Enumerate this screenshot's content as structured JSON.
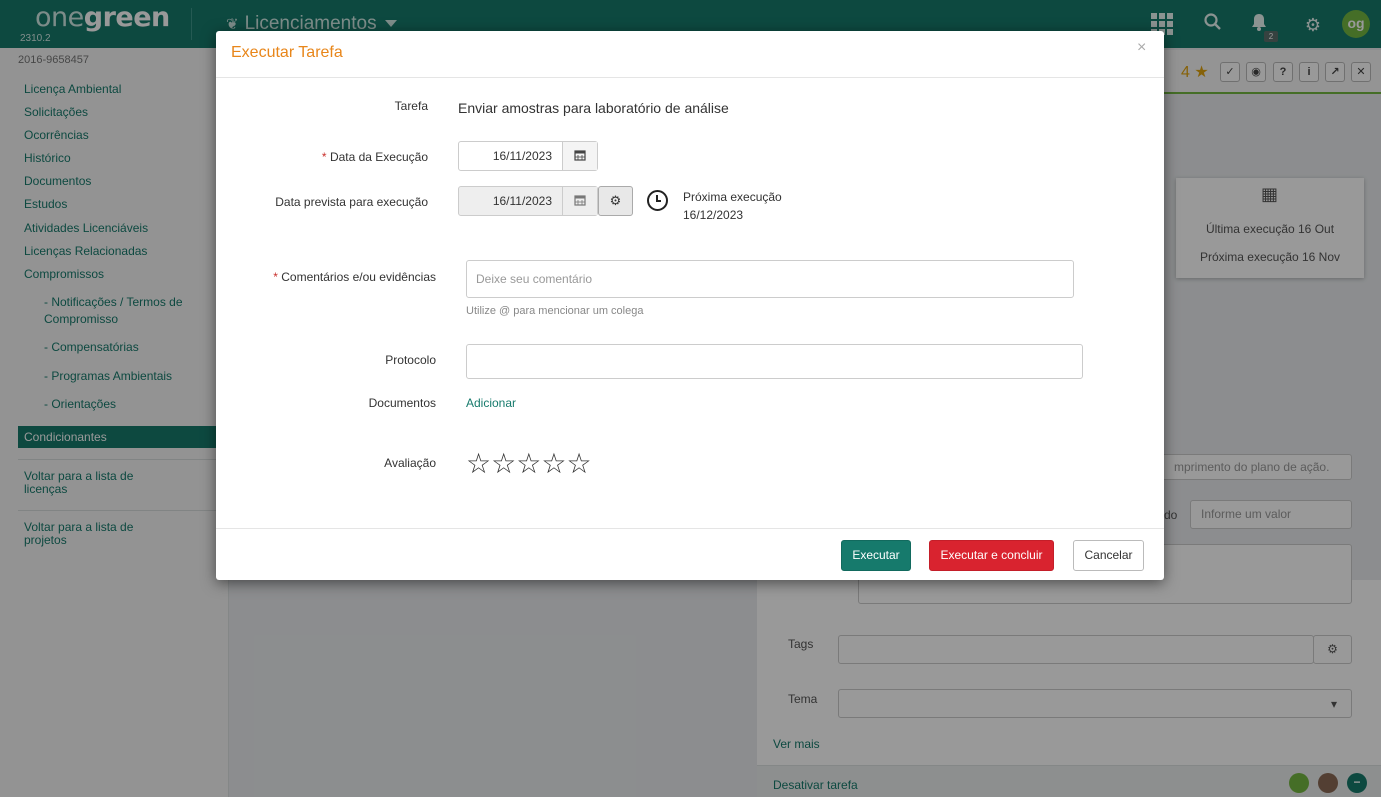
{
  "topbar": {
    "logo_light": "one",
    "logo_bold": "green",
    "version": "2310.2",
    "module": "Licenciamentos",
    "notifications_count": "2",
    "avatar_initials": "og"
  },
  "sidebar": {
    "record_id": "2016-9658457",
    "items": [
      "Licença Ambiental",
      "Solicitações",
      "Ocorrências",
      "Histórico",
      "Documentos",
      "Estudos",
      "Atividades Licenciáveis",
      "Licenças Relacionadas",
      "Compromissos"
    ],
    "sub_items": [
      "- Notificações / Termos de Compromisso",
      "- Compensatórias",
      "- Programas Ambientais",
      "- Orientações"
    ],
    "active_item": "Condicionantes",
    "back_licencas": "Voltar para a lista de licenças",
    "back_projetos": "Voltar para a lista de projetos"
  },
  "right_panel": {
    "star_count": "4",
    "last_execution": "Última execução 16 Out",
    "next_execution": "Próxima execução 16 Nov",
    "plan_placeholder": "mprimento do plano de ação.",
    "field_suffix": "do",
    "value_placeholder": "Informe um valor",
    "tags_label": "Tags",
    "tema_label": "Tema",
    "ver_mais": "Ver mais",
    "desativar": "Desativar tarefa"
  },
  "modal": {
    "title": "Executar Tarefa",
    "close_symbol": "×",
    "tarefa_label": "Tarefa",
    "tarefa_value": "Enviar amostras para laboratório de análise",
    "data_execucao_label": "Data da Execução",
    "data_execucao_value": "16/11/2023",
    "data_prevista_label": "Data prevista para execução",
    "data_prevista_value": "16/11/2023",
    "proxima_label": "Próxima execução",
    "proxima_value": "16/12/2023",
    "comentarios_label": "Comentários e/ou evidências",
    "comentarios_placeholder": "Deixe seu comentário",
    "comentarios_help": "Utilize @ para mencionar um colega",
    "protocolo_label": "Protocolo",
    "protocolo_value": "",
    "documentos_label": "Documentos",
    "adicionar_link": "Adicionar",
    "avaliacao_label": "Avaliação",
    "rating": 0,
    "rating_max": 5,
    "btn_executar": "Executar",
    "btn_executar_concluir": "Executar e concluir",
    "btn_cancelar": "Cancelar"
  },
  "colors": {
    "brand": "#167a6c",
    "title_orange": "#e8861a",
    "danger": "#d9232f"
  }
}
